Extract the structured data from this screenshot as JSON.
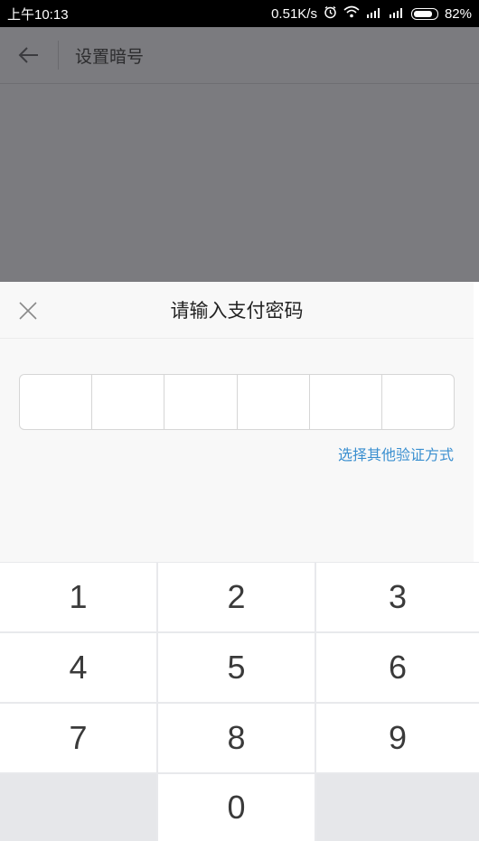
{
  "status_bar": {
    "time": "上午10:13",
    "speed": "0.51K/s",
    "battery": "82%",
    "battery_level": 0.82
  },
  "header": {
    "title": "设置暗号"
  },
  "sheet": {
    "title": "请输入支付密码",
    "pin_length": 6,
    "other_method_link": "选择其他验证方式"
  },
  "keypad": {
    "keys": [
      "1",
      "2",
      "3",
      "4",
      "5",
      "6",
      "7",
      "8",
      "9",
      "0"
    ]
  },
  "colors": {
    "link": "#3a8fd0",
    "overlay": "#7b7b7f",
    "keypad_bg": "#e8e9ec"
  }
}
